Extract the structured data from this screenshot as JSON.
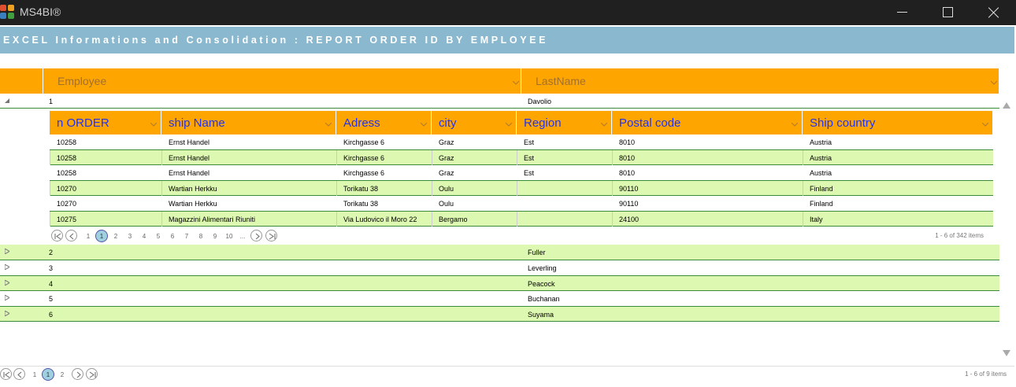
{
  "app": {
    "title": "MS4BI®",
    "logo_colors": [
      "#e05030",
      "#f0a020",
      "#3a80c0",
      "#40a040"
    ]
  },
  "banner": {
    "title": "EXCEL Informations and Consolidation : REPORT ORDER ID BY EMPLOYEE"
  },
  "colors": {
    "header": "#ffa500",
    "banner": "#8ab8ce",
    "alt_row": "#ddf8b0",
    "child_header_text": "#2233ee"
  },
  "grid": {
    "columns": [
      "Employee",
      "LastName"
    ],
    "rows": [
      {
        "employee": "1",
        "lastname": "Davolio",
        "expanded": true
      },
      {
        "employee": "2",
        "lastname": "Fuller",
        "expanded": false
      },
      {
        "employee": "3",
        "lastname": "Leverling",
        "expanded": false
      },
      {
        "employee": "4",
        "lastname": "Peacock",
        "expanded": false
      },
      {
        "employee": "5",
        "lastname": "Buchanan",
        "expanded": false
      },
      {
        "employee": "6",
        "lastname": "Suyama",
        "expanded": false
      }
    ],
    "pager": {
      "pages": [
        "1",
        "2"
      ],
      "current": "1",
      "info": "1 - 6 of 9 items"
    }
  },
  "detail": {
    "columns": [
      "n ORDER",
      "ship Name",
      "Adress",
      "city",
      "Region",
      "Postal code",
      "Ship country"
    ],
    "rows": [
      [
        "10258",
        "Ernst Handel",
        "Kirchgasse 6",
        "Graz",
        "Est",
        "8010",
        "Austria"
      ],
      [
        "10258",
        "Ernst Handel",
        "Kirchgasse 6",
        "Graz",
        "Est",
        "8010",
        "Austria"
      ],
      [
        "10258",
        "Ernst Handel",
        "Kirchgasse 6",
        "Graz",
        "Est",
        "8010",
        "Austria"
      ],
      [
        "10270",
        "Wartian Herkku",
        "Torikatu 38",
        "Oulu",
        "",
        "90110",
        "Finland"
      ],
      [
        "10270",
        "Wartian Herkku",
        "Torikatu 38",
        "Oulu",
        "",
        "90110",
        "Finland"
      ],
      [
        "10275",
        "Magazzini Alimentari Riuniti",
        "Via Ludovico il Moro 22",
        "Bergamo",
        "",
        "24100",
        "Italy"
      ]
    ],
    "pager": {
      "pages": [
        "1",
        "2",
        "3",
        "4",
        "5",
        "6",
        "7",
        "8",
        "9",
        "10",
        "..."
      ],
      "current": "1",
      "info": "1 - 6 of 342 items"
    }
  }
}
